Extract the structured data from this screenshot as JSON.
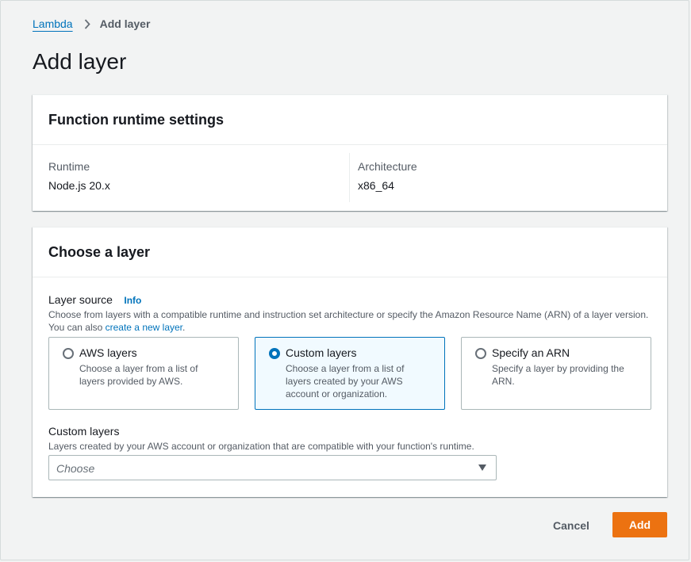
{
  "breadcrumb": {
    "root": "Lambda",
    "current": "Add layer"
  },
  "page_title": "Add layer",
  "runtime_panel": {
    "title": "Function runtime settings",
    "runtime_label": "Runtime",
    "runtime_value": "Node.js 20.x",
    "architecture_label": "Architecture",
    "architecture_value": "x86_64"
  },
  "layer_panel": {
    "title": "Choose a layer",
    "source_label": "Layer source",
    "info_link": "Info",
    "source_desc_prefix": "Choose from layers with a compatible runtime and instruction set architecture or specify the Amazon Resource Name (ARN) of a layer version. You can also ",
    "source_desc_link": "create a new layer",
    "source_desc_suffix": ".",
    "options": [
      {
        "title": "AWS layers",
        "desc": "Choose a layer from a list of layers provided by AWS.",
        "selected": false
      },
      {
        "title": "Custom layers",
        "desc": "Choose a layer from a list of layers created by your AWS account or organization.",
        "selected": true
      },
      {
        "title": "Specify an ARN",
        "desc": "Specify a layer by providing the ARN.",
        "selected": false
      }
    ],
    "custom_label": "Custom layers",
    "custom_desc": "Layers created by your AWS account or organization that are compatible with your function's runtime.",
    "select_placeholder": "Choose"
  },
  "actions": {
    "cancel": "Cancel",
    "add": "Add"
  },
  "colors": {
    "accent": "#0073bb",
    "primary_button": "#ec7211",
    "selected_tile_bg": "#f1faff"
  }
}
